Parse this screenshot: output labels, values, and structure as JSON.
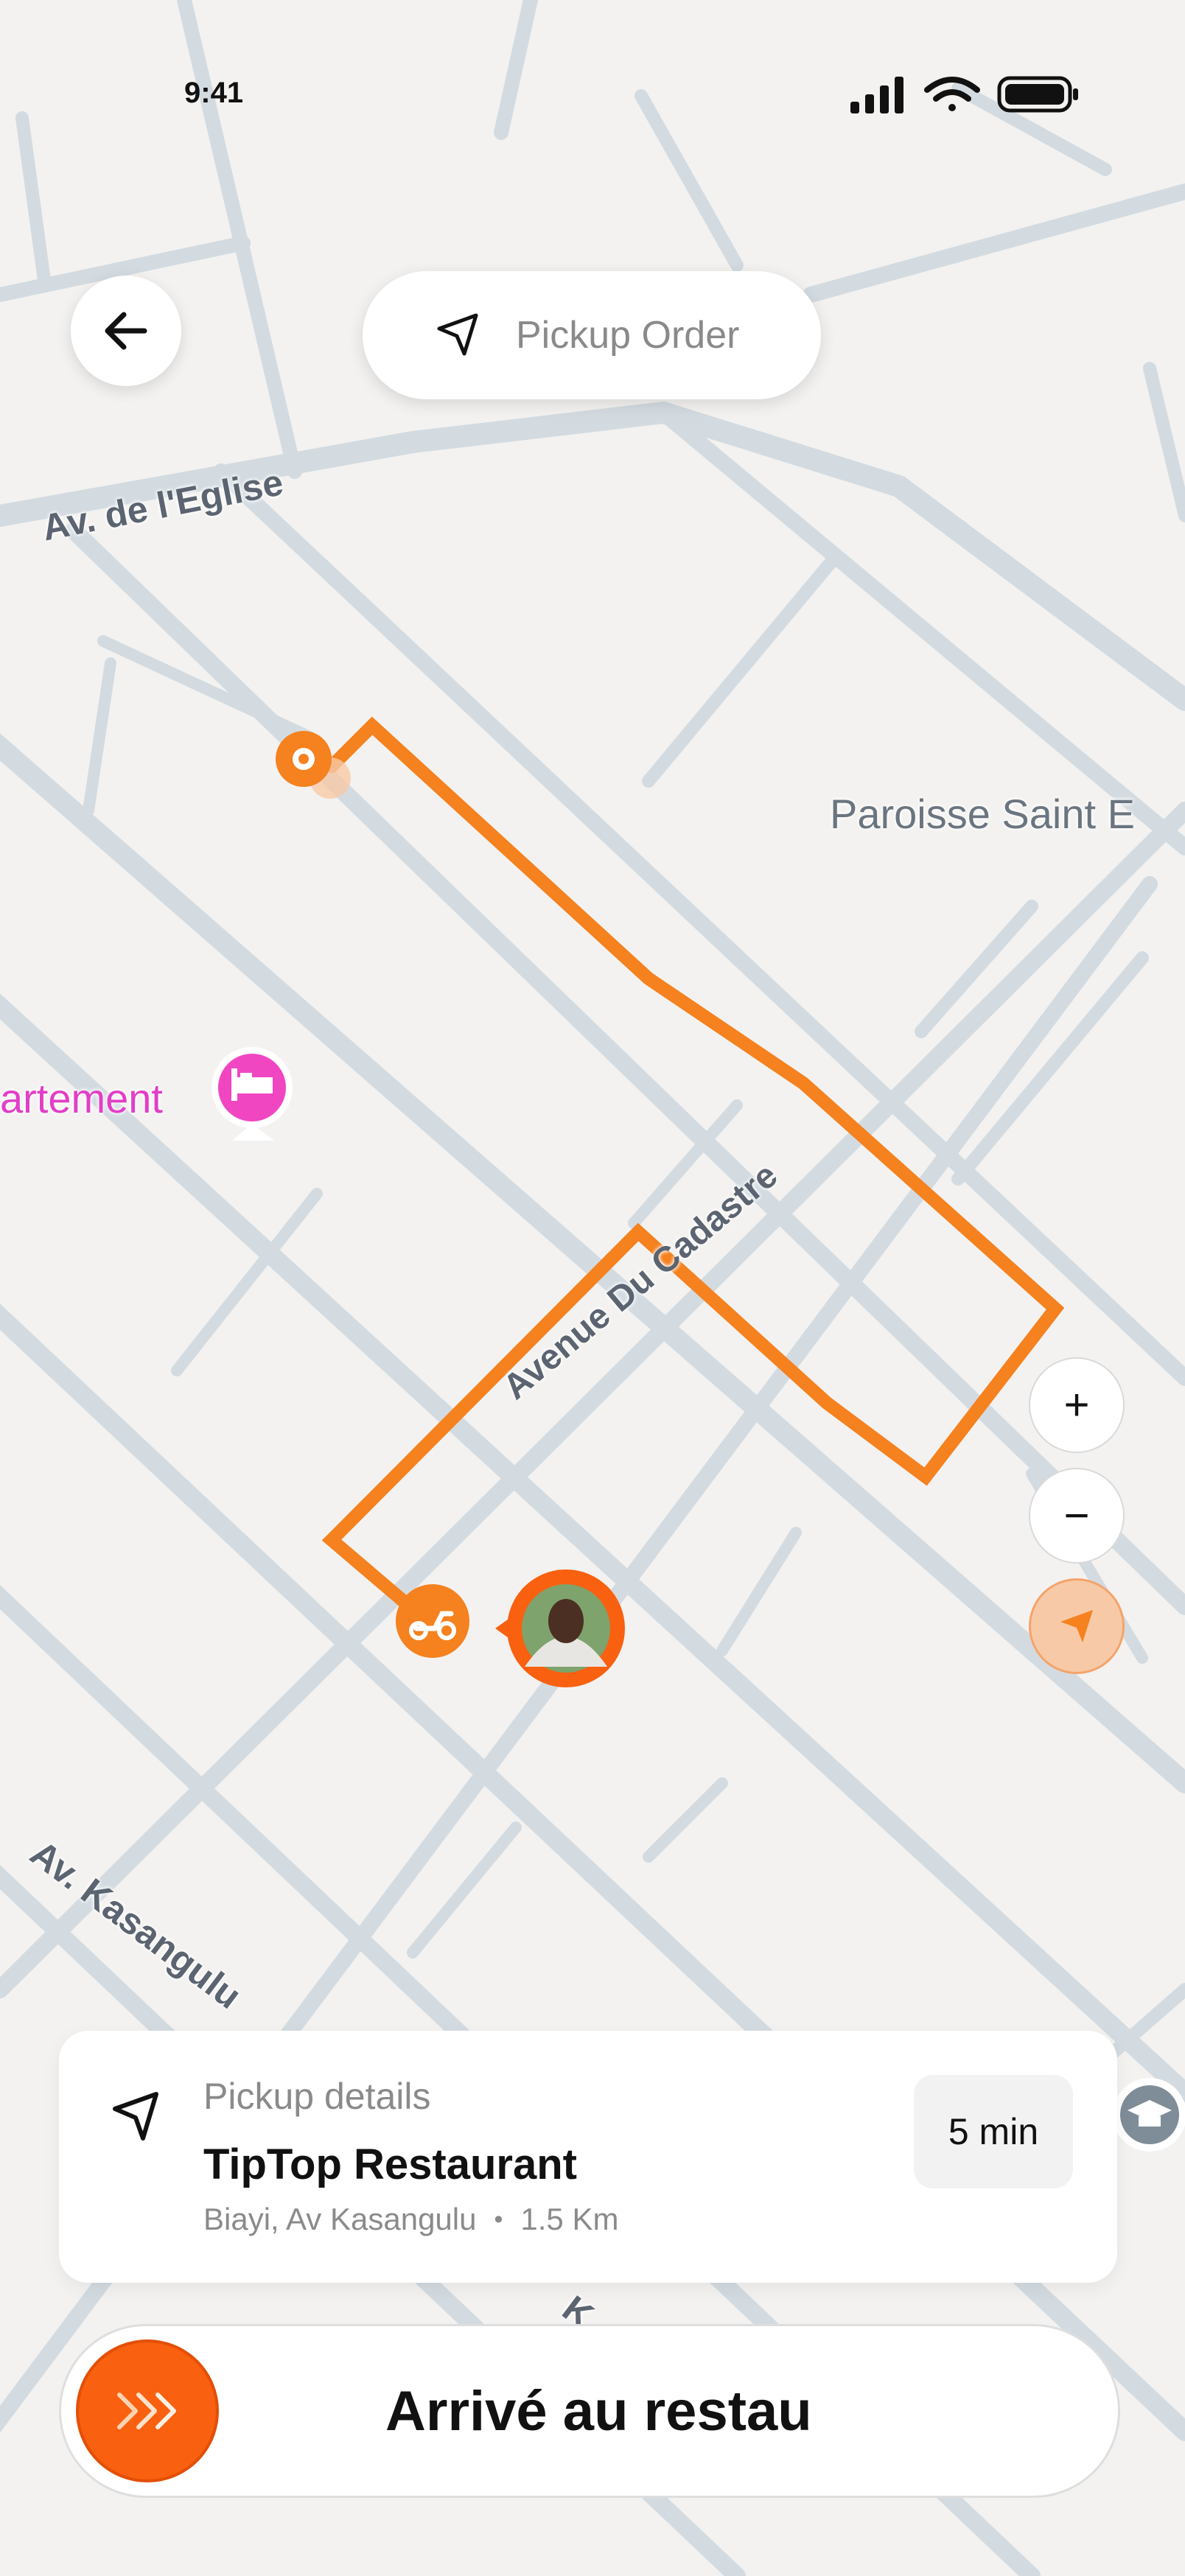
{
  "status_bar": {
    "time": "9:41"
  },
  "header": {
    "back_icon": "arrow-left-icon",
    "title": "Pickup Order",
    "title_icon": "navigation-arrow-icon"
  },
  "map": {
    "road_labels": [
      "Av. de l'Eglise",
      "Avenue Du Cadastre",
      "Av. Kasangulu",
      "K"
    ],
    "poi_labels": [
      {
        "text": "Paroisse Saint E",
        "color": "#6b7580"
      },
      {
        "text": "artement",
        "color": "#e23ec6"
      }
    ],
    "route_color": "#f5811f",
    "hotel_icon": "bed-icon",
    "school_icon": "graduation-cap-icon",
    "rider_icon": "scooter-icon",
    "driver_avatar": "avatar"
  },
  "controls": {
    "zoom_in": "+",
    "zoom_out": "−",
    "locate_icon": "location-arrow-icon"
  },
  "pickup": {
    "label": "Pickup details",
    "restaurant": "TipTop Restaurant",
    "area": "Biayi, Av Kasangulu",
    "separator": "•",
    "distance": "1.5 Km",
    "eta": "5 min"
  },
  "action": {
    "label": "Arrivé au restau",
    "handle_icon": "chevrons-right-icon"
  },
  "colors": {
    "accent": "#f9600f",
    "route": "#f5811f",
    "poi_pink": "#e23ec6"
  }
}
